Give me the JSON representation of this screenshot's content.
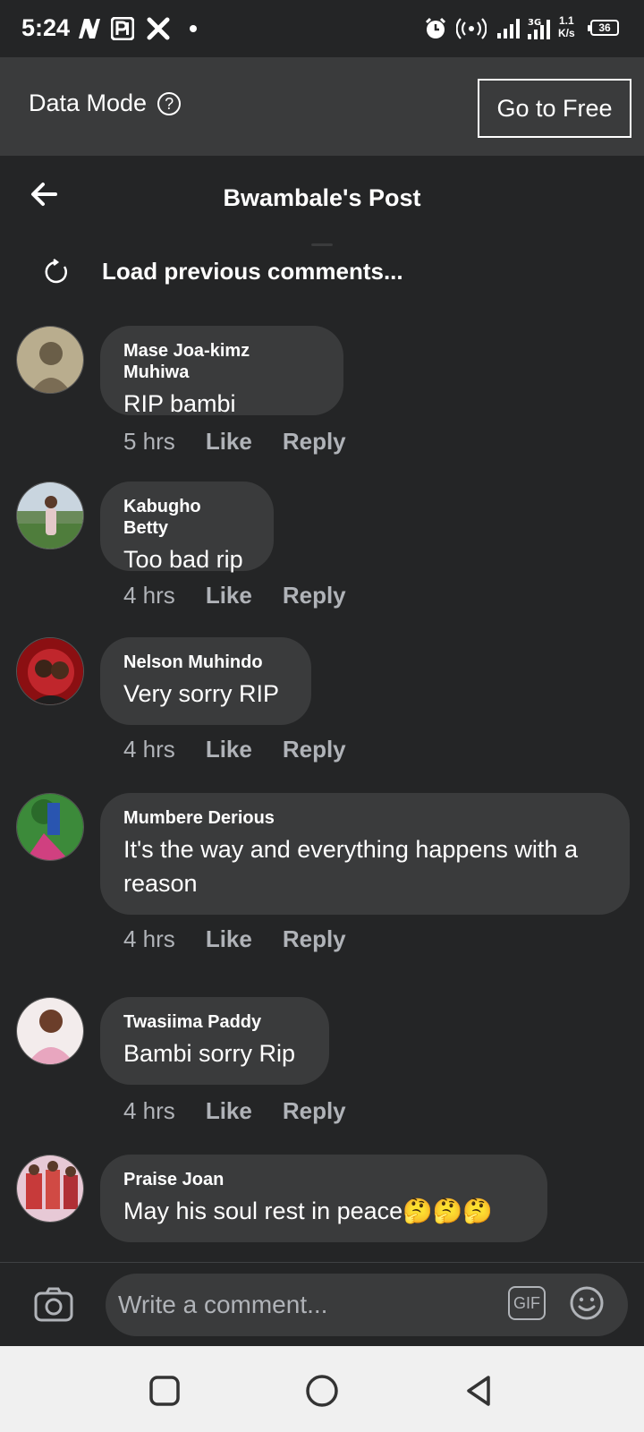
{
  "status_bar": {
    "time": "5:24",
    "net_speed_value": "1.1",
    "net_speed_unit": "K/s",
    "battery": "36",
    "icons": [
      "n-logo-icon",
      "p-app-icon",
      "x-app-icon",
      "dot-icon",
      "alarm-icon",
      "hotspot-icon",
      "signal-icon",
      "signal-3g-icon",
      "battery-icon"
    ]
  },
  "banner": {
    "data_mode_label": "Data Mode",
    "go_free_label": "Go to Free"
  },
  "header": {
    "title": "Bwambale's Post"
  },
  "load_previous": "Load previous comments...",
  "comments": [
    {
      "author": "Mase Joa-kimz Muhiwa",
      "text": "RIP bambi",
      "time": "5 hrs",
      "like": "Like",
      "reply": "Reply"
    },
    {
      "author": "Kabugho Betty",
      "text": "Too bad rip",
      "time": "4 hrs",
      "like": "Like",
      "reply": "Reply"
    },
    {
      "author": "Nelson Muhindo",
      "text": "Very sorry RIP",
      "time": "4 hrs",
      "like": "Like",
      "reply": "Reply"
    },
    {
      "author": "Mumbere Derious",
      "text": "It's the way and everything happens with a reason",
      "time": "4 hrs",
      "like": "Like",
      "reply": "Reply"
    },
    {
      "author": "Twasiima Paddy",
      "text": "Bambi sorry Rip",
      "time": "4 hrs",
      "like": "Like",
      "reply": "Reply"
    },
    {
      "author": "Praise Joan",
      "text": "May his soul rest in peace🤔🤔🤔",
      "time": "",
      "like": "",
      "reply": ""
    }
  ],
  "composer": {
    "placeholder": "Write a comment...",
    "gif_label": "GIF"
  },
  "colors": {
    "background": "#242526",
    "bubble": "#3a3b3c",
    "banner": "#3a3b3c",
    "muted_text": "#b0b3b8",
    "nav_bar": "#f0f0f0"
  }
}
